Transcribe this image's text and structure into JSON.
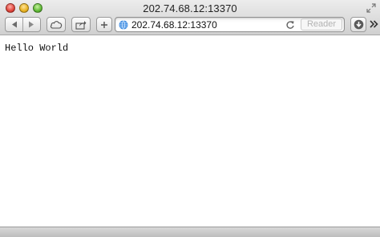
{
  "window": {
    "title": "202.74.68.12:13370"
  },
  "toolbar": {
    "back": {
      "icon": "back-arrow-icon"
    },
    "forward": {
      "icon": "forward-arrow-icon"
    },
    "icloud": {
      "icon": "cloud-icon"
    },
    "share": {
      "icon": "share-icon"
    },
    "add": {
      "icon": "plus-icon"
    },
    "download": {
      "icon": "download-icon"
    },
    "overflow": {
      "icon": "chevron-double-right-icon"
    }
  },
  "address_bar": {
    "url": "202.74.68.12:13370",
    "reader_label": "Reader"
  },
  "page": {
    "text": "Hello World"
  },
  "colors": {
    "chrome_top": "#ececec",
    "chrome_bottom": "#d0d0d0",
    "page_background": "#ffffff"
  }
}
